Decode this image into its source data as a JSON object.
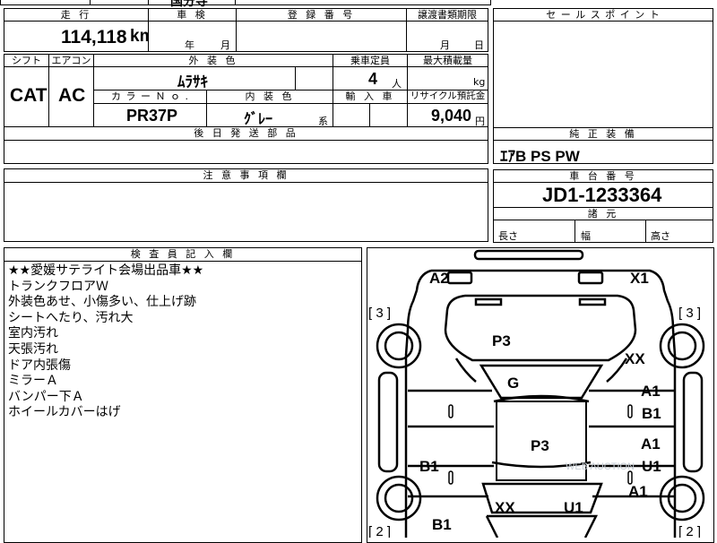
{
  "top_cut": {
    "left_text": "",
    "mid_text": "国分寺"
  },
  "mileage": {
    "header": "走 行",
    "value": "114,118",
    "unit": "km"
  },
  "inspection": {
    "header": "車 検",
    "year_label": "年",
    "month_label": "月"
  },
  "registration": {
    "header": "登 録 番 号"
  },
  "transfer": {
    "header": "譲渡書類期限",
    "month_label": "月",
    "day_label": "日"
  },
  "sales_point": {
    "header": "セ ー ル ス ポ イ ン ト"
  },
  "shift": {
    "header": "シフト",
    "value": "CAT"
  },
  "aircon": {
    "header": "エアコン",
    "value": "AC"
  },
  "exterior_color": {
    "header": "外 装 色",
    "value": "ﾑﾗｻｷ"
  },
  "capacity": {
    "header": "乗車定員",
    "value": "4",
    "unit": "人"
  },
  "max_load": {
    "header": "最大積載量",
    "unit": "kg"
  },
  "color_no": {
    "header": "カ ラ ー Ｎ ｏ .",
    "value": "PR37P"
  },
  "interior_color": {
    "header": "内 装 色",
    "value": "ｸﾞﾚｰ",
    "suffix": "系"
  },
  "import": {
    "header": "輸 入 車"
  },
  "recycle": {
    "header": "リサイクル預託金",
    "value": "9,040",
    "unit": "円"
  },
  "later_parts": {
    "header": "後 日 発 送 部 品"
  },
  "genuine": {
    "header": "純 正 装 備",
    "value": "ｴｱB PS PW"
  },
  "notes": {
    "header": "注 意 事 項 欄"
  },
  "chassis": {
    "header": "車 台 番 号",
    "value": "JD1-1233364"
  },
  "dimensions": {
    "header": "諸 元",
    "length_label": "長さ",
    "width_label": "幅",
    "height_label": "高さ"
  },
  "inspector": {
    "header": "検 査 員 記 入 欄",
    "lines": [
      "★★愛媛サテライト会場出品車★★",
      "トランクフロアＷ",
      "外装色あせ、小傷多い、仕上げ跡",
      "シートへたり、汚れ大",
      "室内汚れ",
      "天張汚れ",
      "ドア内張傷",
      "ミラーＡ",
      "バンパー下Ａ",
      "ホイールカバーはげ"
    ]
  },
  "diagram": {
    "marks": [
      {
        "id": "a2",
        "text": "A2"
      },
      {
        "id": "x1",
        "text": "X1"
      },
      {
        "id": "p3-front",
        "text": "P3"
      },
      {
        "id": "xx-right",
        "text": "XX"
      },
      {
        "id": "g",
        "text": "G"
      },
      {
        "id": "a1-door1",
        "text": "A1"
      },
      {
        "id": "b1-door1",
        "text": "B1"
      },
      {
        "id": "p3-roof",
        "text": "P3"
      },
      {
        "id": "a1-door2",
        "text": "A1"
      },
      {
        "id": "u1-door2",
        "text": "U1"
      },
      {
        "id": "b1-left",
        "text": "B1"
      },
      {
        "id": "a1-rear",
        "text": "A1"
      },
      {
        "id": "xx-rear",
        "text": "XX"
      },
      {
        "id": "u1-rear",
        "text": "U1"
      },
      {
        "id": "b1-rear",
        "text": "B1"
      }
    ],
    "brackets": [
      {
        "id": "tl",
        "text": "[ 3 ]"
      },
      {
        "id": "tr",
        "text": "[ 3 ]"
      },
      {
        "id": "bl",
        "text": "[ 2 ]"
      },
      {
        "id": "br",
        "text": "[ 2 ]"
      }
    ],
    "watermark": "WEB AUCTION"
  }
}
